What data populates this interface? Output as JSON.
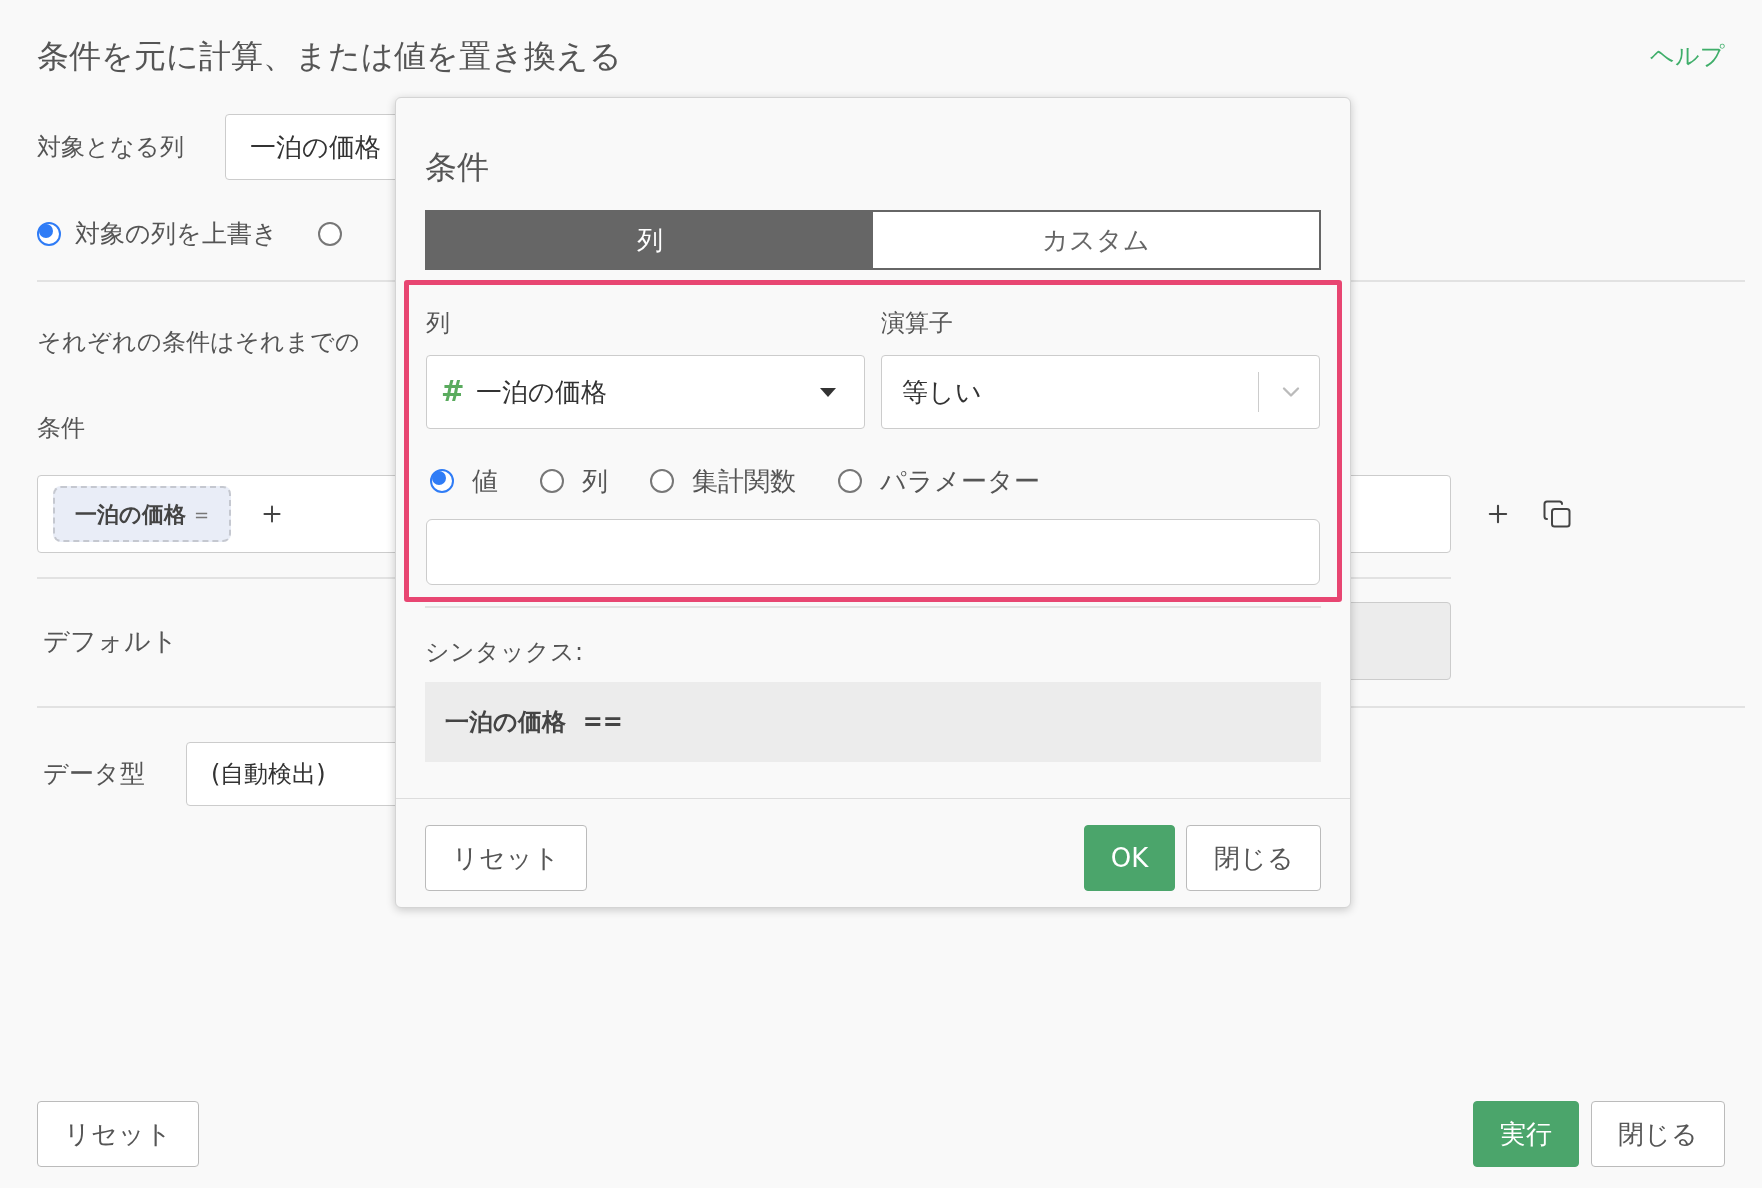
{
  "title": "条件を元に計算、または値を置き換える",
  "help_link": "ヘルプ",
  "target_column": {
    "label": "対象となる列",
    "value": "一泊の価格"
  },
  "output_options": [
    {
      "label": "対象の列を上書き",
      "selected": true
    },
    {
      "selected": false
    }
  ],
  "description": "それぞれの条件はそれまでの",
  "conditions": {
    "label": "条件",
    "chips": [
      {
        "column": "一泊の価格",
        "operator": "="
      }
    ]
  },
  "default": {
    "label": "デフォルト"
  },
  "data_type": {
    "label": "データ型",
    "value": "(自動検出)"
  },
  "footer_buttons": [
    {
      "label": "リセット",
      "kind": "secondary"
    },
    {
      "label": "実行",
      "kind": "primary"
    },
    {
      "label": "閉じる",
      "kind": "secondary"
    }
  ],
  "dialog": {
    "title": "条件",
    "tabs": [
      {
        "label": "列",
        "selected": true
      },
      {
        "label": "カスタム",
        "selected": false
      }
    ],
    "column_field": {
      "label": "列",
      "type_symbol": "#",
      "value": "一泊の価格"
    },
    "operator_field": {
      "label": "演算子",
      "value": "等しい"
    },
    "value_types": [
      {
        "label": "値",
        "selected": true
      },
      {
        "label": "列",
        "selected": false
      },
      {
        "label": "集計関数",
        "selected": false
      },
      {
        "label": "パラメーター",
        "selected": false
      }
    ],
    "syntax": {
      "label": "シンタックス:",
      "expression": "一泊の価格  =="
    },
    "buttons": [
      {
        "label": "リセット",
        "kind": "secondary"
      },
      {
        "label": "OK",
        "kind": "primary"
      },
      {
        "label": "閉じる",
        "kind": "secondary"
      }
    ]
  }
}
